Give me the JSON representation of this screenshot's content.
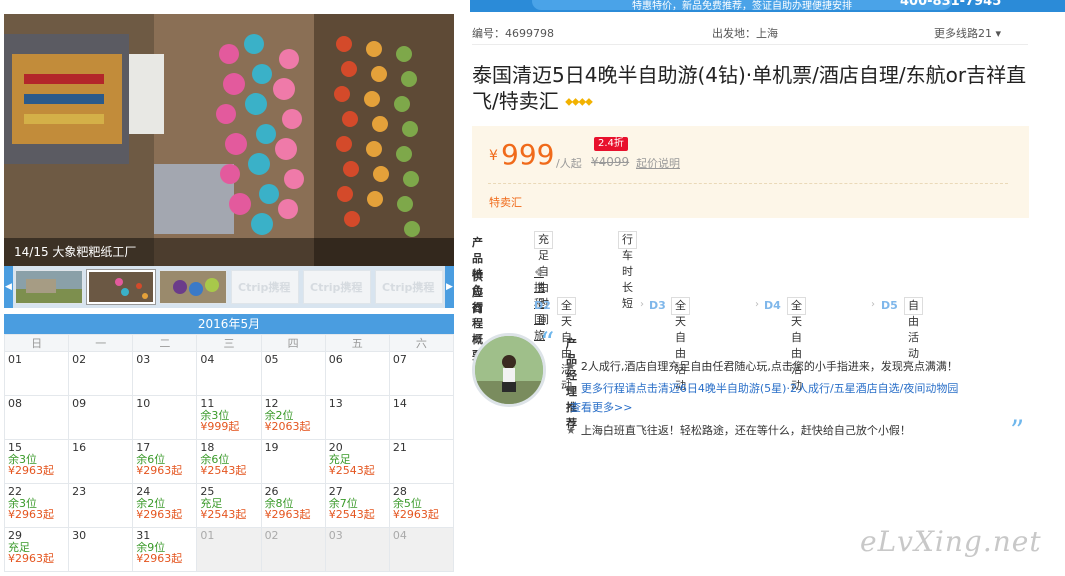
{
  "topbar": {
    "promo": "特惠特价，新品免费推荐，签证自助办理便捷安排",
    "phone": "400-831-7945"
  },
  "gallery": {
    "caption": "14/15 大象粑粑纸工厂",
    "left_arrow": "◀",
    "right_arrow": "▶",
    "watermark": "Ctrip携程"
  },
  "calendar": {
    "month": "2016年5月",
    "weekdays": [
      "日",
      "一",
      "二",
      "三",
      "四",
      "五",
      "六"
    ],
    "weeks": [
      [
        {
          "d": "01"
        },
        {
          "d": "02"
        },
        {
          "d": "03"
        },
        {
          "d": "04"
        },
        {
          "d": "05"
        },
        {
          "d": "06"
        },
        {
          "d": "07"
        }
      ],
      [
        {
          "d": "08"
        },
        {
          "d": "09"
        },
        {
          "d": "10"
        },
        {
          "d": "11",
          "s": "余3位",
          "p": "¥999起"
        },
        {
          "d": "12",
          "s": "余2位",
          "p": "¥2063起"
        },
        {
          "d": "13"
        },
        {
          "d": "14"
        }
      ],
      [
        {
          "d": "15",
          "s": "余3位",
          "p": "¥2963起"
        },
        {
          "d": "16"
        },
        {
          "d": "17",
          "s": "余6位",
          "p": "¥2963起"
        },
        {
          "d": "18",
          "s": "余6位",
          "p": "¥2543起"
        },
        {
          "d": "19"
        },
        {
          "d": "20",
          "s": "充足",
          "p": "¥2543起"
        },
        {
          "d": "21"
        }
      ],
      [
        {
          "d": "22",
          "s": "余3位",
          "p": "¥2963起"
        },
        {
          "d": "23"
        },
        {
          "d": "24",
          "s": "余2位",
          "p": "¥2963起"
        },
        {
          "d": "25",
          "s": "充足",
          "p": "¥2543起"
        },
        {
          "d": "26",
          "s": "余8位",
          "p": "¥2963起"
        },
        {
          "d": "27",
          "s": "余7位",
          "p": "¥2543起"
        },
        {
          "d": "28",
          "s": "余5位",
          "p": "¥2963起"
        }
      ],
      [
        {
          "d": "29",
          "s": "充足",
          "p": "¥2963起"
        },
        {
          "d": "30"
        },
        {
          "d": "31",
          "s": "余9位",
          "p": "¥2963起"
        },
        {
          "d": "01",
          "dis": true
        },
        {
          "d": "02",
          "dis": true
        },
        {
          "d": "03",
          "dis": true
        },
        {
          "d": "04",
          "dis": true
        }
      ]
    ]
  },
  "product": {
    "id_label": "编号：4699798",
    "depart_label": "出发地：上海",
    "more_routes": "更多线路21",
    "title": "泰国清迈5日4晚半自助游(4钻)·单机票/酒店自理/东航or吉祥直飞/特卖汇",
    "diamonds": "◆◆◆◆",
    "price": {
      "currency": "¥",
      "value": "999",
      "per": "/人起",
      "original": "¥4099",
      "discount": "2.4折",
      "explain": "起价说明",
      "tag": "特卖汇"
    },
    "features_label": "产品特色",
    "features": [
      "充足自由时间",
      "行车时长短"
    ],
    "supplier_label": "供 应 商",
    "supplier_icon": "ctrip-icon",
    "supplier": "携程国旅",
    "itinerary_label": "行程概要",
    "itinerary": [
      {
        "day": "D2",
        "text": "全天自由活动"
      },
      {
        "day": "D3",
        "text": "全天自由活动"
      },
      {
        "day": "D4",
        "text": "全天自由活动"
      },
      {
        "day": "D5",
        "text": "自由活动"
      }
    ],
    "recommend": {
      "heading": "产品经理推荐",
      "open_quote": "“",
      "close_quote": "”",
      "star": "★",
      "line1": "2人成行,酒店自理充足自由任君随心玩,点击您的小手指进来，发现亮点满满！",
      "line2": "更多行程请点击清迈6日4晚半自助游(5星)·2人成行/五星酒店自选/夜间动物园",
      "view_more": "查看更多>>",
      "line3": "上海白班直飞往返！轻松路途，还在等什么，赶快给自己放个小假！"
    }
  },
  "watermark": "eLvXing.net"
}
